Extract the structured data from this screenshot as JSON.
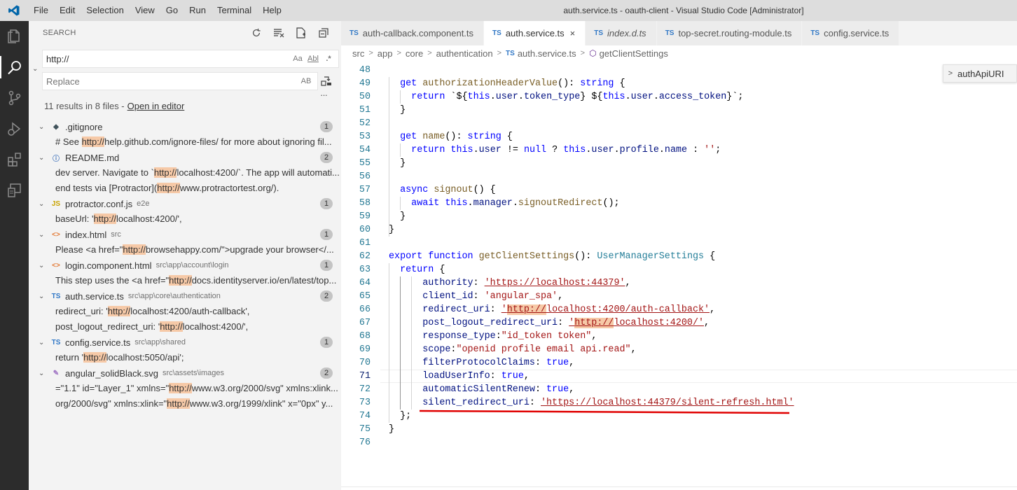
{
  "window": {
    "title": "auth.service.ts - oauth-client - Visual Studio Code [Administrator]",
    "menu": [
      "File",
      "Edit",
      "Selection",
      "View",
      "Go",
      "Run",
      "Terminal",
      "Help"
    ]
  },
  "sidebar": {
    "header": "SEARCH",
    "search_value": "http://",
    "replace_placeholder": "Replace",
    "opt_case": "Aa",
    "opt_word": "Abl",
    "opt_regex": ".*",
    "opt_preserve": "AB",
    "summary": "11 results in 8 files -",
    "open_in_editor": "Open in editor",
    "more": "···",
    "files": [
      {
        "icon": "git",
        "name": ".gitignore",
        "path": "",
        "count": "1",
        "matches": [
          {
            "pre": "# See ",
            "hit": "http://",
            "post": "help.github.com/ignore-files/ for more about ignoring fil..."
          }
        ]
      },
      {
        "icon": "info",
        "name": "README.md",
        "path": "",
        "count": "2",
        "matches": [
          {
            "pre": "dev server. Navigate to `",
            "hit": "http://",
            "post": "localhost:4200/`. The app will automati..."
          },
          {
            "pre": "end tests via [Protractor](",
            "hit": "http://",
            "post": "www.protractortest.org/)."
          }
        ]
      },
      {
        "icon": "js",
        "name": "protractor.conf.js",
        "path": "e2e",
        "count": "1",
        "matches": [
          {
            "pre": "baseUrl: '",
            "hit": "http://",
            "post": "localhost:4200/',"
          }
        ]
      },
      {
        "icon": "html",
        "name": "index.html",
        "path": "src",
        "count": "1",
        "matches": [
          {
            "pre": "Please <a href=\"",
            "hit": "http://",
            "post": "browsehappy.com/\">upgrade your browser</..."
          }
        ]
      },
      {
        "icon": "html",
        "name": "login.component.html",
        "path": "src\\app\\account\\login",
        "count": "1",
        "matches": [
          {
            "pre": "This step uses the <a href=\"",
            "hit": "http://",
            "post": "docs.identityserver.io/en/latest/top..."
          }
        ]
      },
      {
        "icon": "ts",
        "name": "auth.service.ts",
        "path": "src\\app\\core\\authentication",
        "count": "2",
        "matches": [
          {
            "pre": "redirect_uri: '",
            "hit": "http://",
            "post": "localhost:4200/auth-callback',"
          },
          {
            "pre": "post_logout_redirect_uri: '",
            "hit": "http://",
            "post": "localhost:4200/',"
          }
        ]
      },
      {
        "icon": "ts",
        "name": "config.service.ts",
        "path": "src\\app\\shared",
        "count": "1",
        "matches": [
          {
            "pre": "return '",
            "hit": "http://",
            "post": "localhost:5050/api';"
          }
        ]
      },
      {
        "icon": "svg",
        "name": "angular_solidBlack.svg",
        "path": "src\\assets\\images",
        "count": "2",
        "matches": [
          {
            "pre": "=\"1.1\" id=\"Layer_1\" xmlns=\"",
            "hit": "http://",
            "post": "www.w3.org/2000/svg\" xmlns:xlink..."
          },
          {
            "pre": "org/2000/svg\" xmlns:xlink=\"",
            "hit": "http://",
            "post": "www.w3.org/1999/xlink\" x=\"0px\" y..."
          }
        ]
      }
    ]
  },
  "editor": {
    "tabs": [
      {
        "label": "auth-callback.component.ts",
        "active": false,
        "italic": false
      },
      {
        "label": "auth.service.ts",
        "active": true,
        "italic": false
      },
      {
        "label": "index.d.ts",
        "active": false,
        "italic": true
      },
      {
        "label": "top-secret.routing-module.ts",
        "active": false,
        "italic": false
      },
      {
        "label": "config.service.ts",
        "active": false,
        "italic": false
      }
    ],
    "tab_prefix": "TS",
    "close_glyph": "×",
    "breadcrumb": [
      "src",
      "app",
      "core",
      "authentication",
      "auth.service.ts",
      "getClientSettings"
    ],
    "peek_label": "authApiURI",
    "current_line": 71,
    "lines": [
      {
        "n": 48,
        "t": []
      },
      {
        "n": 49,
        "t": [
          [
            "  ",
            ""
          ],
          [
            "get",
            "kw"
          ],
          [
            " ",
            ""
          ],
          [
            "authorizationHeaderValue",
            "fn"
          ],
          [
            "(): ",
            ""
          ],
          [
            "string",
            "kt"
          ],
          [
            " {",
            ""
          ]
        ]
      },
      {
        "n": 50,
        "t": [
          [
            "    ",
            ""
          ],
          [
            "return",
            "kw"
          ],
          [
            " `${",
            ""
          ],
          [
            "this",
            "kw"
          ],
          [
            ".",
            ""
          ],
          [
            "user",
            "pr"
          ],
          [
            ".",
            ""
          ],
          [
            "token_type",
            "pr"
          ],
          [
            "} ${",
            ""
          ],
          [
            "this",
            "kw"
          ],
          [
            ".",
            ""
          ],
          [
            "user",
            "pr"
          ],
          [
            ".",
            ""
          ],
          [
            "access_token",
            "pr"
          ],
          [
            "}`;",
            ""
          ]
        ]
      },
      {
        "n": 51,
        "t": [
          [
            "  }",
            ""
          ]
        ]
      },
      {
        "n": 52,
        "t": []
      },
      {
        "n": 53,
        "t": [
          [
            "  ",
            ""
          ],
          [
            "get",
            "kw"
          ],
          [
            " ",
            ""
          ],
          [
            "name",
            "fn"
          ],
          [
            "(): ",
            ""
          ],
          [
            "string",
            "kt"
          ],
          [
            " {",
            ""
          ]
        ]
      },
      {
        "n": 54,
        "t": [
          [
            "    ",
            ""
          ],
          [
            "return",
            "kw"
          ],
          [
            " ",
            ""
          ],
          [
            "this",
            "kw"
          ],
          [
            ".",
            ""
          ],
          [
            "user",
            "pr"
          ],
          [
            " != ",
            ""
          ],
          [
            "null",
            "kw"
          ],
          [
            " ? ",
            ""
          ],
          [
            "this",
            "kw"
          ],
          [
            ".",
            ""
          ],
          [
            "user",
            "pr"
          ],
          [
            ".",
            ""
          ],
          [
            "profile",
            "pr"
          ],
          [
            ".",
            ""
          ],
          [
            "name",
            "pr"
          ],
          [
            " : ",
            ""
          ],
          [
            "''",
            "str"
          ],
          [
            ";",
            ""
          ]
        ]
      },
      {
        "n": 55,
        "t": [
          [
            "  }",
            ""
          ]
        ]
      },
      {
        "n": 56,
        "t": []
      },
      {
        "n": 57,
        "t": [
          [
            "  ",
            ""
          ],
          [
            "async",
            "kw"
          ],
          [
            " ",
            ""
          ],
          [
            "signout",
            "fn"
          ],
          [
            "() {",
            ""
          ]
        ]
      },
      {
        "n": 58,
        "t": [
          [
            "    ",
            ""
          ],
          [
            "await",
            "kw"
          ],
          [
            " ",
            ""
          ],
          [
            "this",
            "kw"
          ],
          [
            ".",
            ""
          ],
          [
            "manager",
            "pr"
          ],
          [
            ".",
            ""
          ],
          [
            "signoutRedirect",
            "fn"
          ],
          [
            "();",
            ""
          ]
        ]
      },
      {
        "n": 59,
        "t": [
          [
            "  }",
            ""
          ]
        ]
      },
      {
        "n": 60,
        "t": [
          [
            "}",
            ""
          ]
        ]
      },
      {
        "n": 61,
        "t": []
      },
      {
        "n": 62,
        "t": [
          [
            "export",
            "kw"
          ],
          [
            " ",
            ""
          ],
          [
            "function",
            "kw"
          ],
          [
            " ",
            ""
          ],
          [
            "getClientSettings",
            "fn"
          ],
          [
            "(): ",
            ""
          ],
          [
            "UserManagerSettings",
            "ty"
          ],
          [
            " {",
            ""
          ]
        ]
      },
      {
        "n": 63,
        "t": [
          [
            "  ",
            ""
          ],
          [
            "return",
            "kw"
          ],
          [
            " {",
            ""
          ]
        ]
      },
      {
        "n": 64,
        "t": [
          [
            "      ",
            ""
          ],
          [
            "authority",
            "pr"
          ],
          [
            ": ",
            ""
          ],
          [
            "'https://localhost:44379'",
            "str"
          ],
          [
            ",",
            ""
          ]
        ]
      },
      {
        "n": 65,
        "t": [
          [
            "      ",
            ""
          ],
          [
            "client_id",
            "pr"
          ],
          [
            ": ",
            ""
          ],
          [
            "'angular_spa'",
            "str"
          ],
          [
            ",",
            ""
          ]
        ]
      },
      {
        "n": 66,
        "t": [
          [
            "      ",
            ""
          ],
          [
            "redirect_uri",
            "pr"
          ],
          [
            ": ",
            ""
          ],
          [
            "'http://localhost:4200/auth-callback'",
            "str"
          ],
          [
            ",",
            ""
          ]
        ]
      },
      {
        "n": 67,
        "t": [
          [
            "      ",
            ""
          ],
          [
            "post_logout_redirect_uri",
            "pr"
          ],
          [
            ": ",
            ""
          ],
          [
            "'http://localhost:4200/'",
            "str"
          ],
          [
            ",",
            ""
          ]
        ]
      },
      {
        "n": 68,
        "t": [
          [
            "      ",
            ""
          ],
          [
            "response_type",
            "pr"
          ],
          [
            ":",
            ""
          ],
          [
            "\"id_token token\"",
            "str"
          ],
          [
            ",",
            ""
          ]
        ]
      },
      {
        "n": 69,
        "t": [
          [
            "      ",
            ""
          ],
          [
            "scope",
            "pr"
          ],
          [
            ":",
            ""
          ],
          [
            "\"openid profile email api.read\"",
            "str"
          ],
          [
            ",",
            ""
          ]
        ]
      },
      {
        "n": 70,
        "t": [
          [
            "      ",
            ""
          ],
          [
            "filterProtocolClaims",
            "pr"
          ],
          [
            ": ",
            ""
          ],
          [
            "true",
            "kw"
          ],
          [
            ",",
            ""
          ]
        ]
      },
      {
        "n": 71,
        "t": [
          [
            "      ",
            ""
          ],
          [
            "loadUserInfo",
            "pr"
          ],
          [
            ": ",
            ""
          ],
          [
            "true",
            "kw"
          ],
          [
            ",",
            ""
          ]
        ]
      },
      {
        "n": 72,
        "t": [
          [
            "      ",
            ""
          ],
          [
            "automaticSilentRenew",
            "pr"
          ],
          [
            ": ",
            ""
          ],
          [
            "true",
            "kw"
          ],
          [
            ",",
            ""
          ]
        ]
      },
      {
        "n": 73,
        "t": [
          [
            "      ",
            ""
          ],
          [
            "silent_redirect_uri",
            "pr"
          ],
          [
            ": ",
            ""
          ],
          [
            "'https://localhost:44379/silent-refresh.html'",
            "str"
          ]
        ]
      },
      {
        "n": 74,
        "t": [
          [
            "  };",
            ""
          ]
        ]
      },
      {
        "n": 75,
        "t": [
          [
            "}",
            ""
          ]
        ]
      },
      {
        "n": 76,
        "t": []
      }
    ]
  },
  "colors": {
    "accent": "#007acc",
    "annotation": "#e00000",
    "match_highlight": "#f6c9a7"
  }
}
